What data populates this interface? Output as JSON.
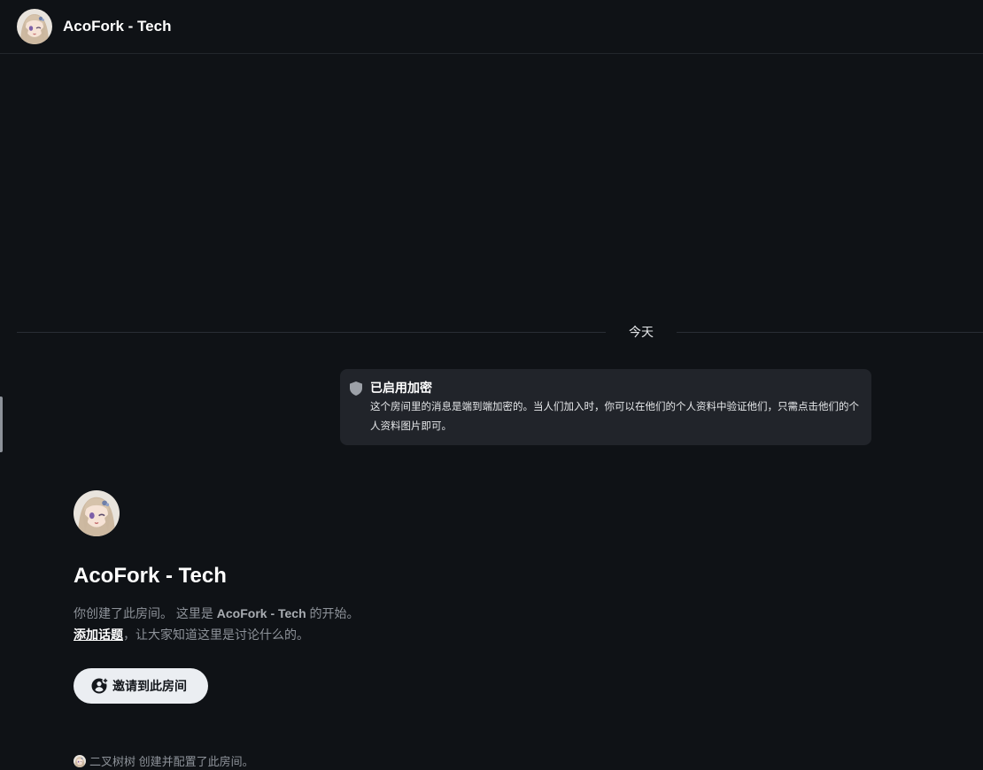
{
  "header": {
    "room_name": "AcoFork - Tech"
  },
  "timeline": {
    "date_separator": "今天"
  },
  "encryption": {
    "title": "已启用加密",
    "body": "这个房间里的消息是端到端加密的。当人们加入时，你可以在他们的个人资料中验证他们，只需点击他们的个人资料图片即可。",
    "icon": "shield-icon"
  },
  "room_intro": {
    "name": "AcoFork - Tech",
    "created_prefix": "你创建了此房间。 这里是 ",
    "created_room": "AcoFork - Tech",
    "created_suffix": " 的开始。",
    "add_topic_link": "添加话题",
    "add_topic_rest": "，让大家知道这里是讨论什么的。",
    "invite_button": "邀请到此房间",
    "invite_icon": "user-add-icon"
  },
  "events": {
    "creator": "二叉树树",
    "created_text": " 创建并配置了此房间。"
  },
  "colors": {
    "background": "#0f1216",
    "card": "#21242a",
    "muted_text": "#8d9299",
    "button_bg": "#ebeef2"
  }
}
